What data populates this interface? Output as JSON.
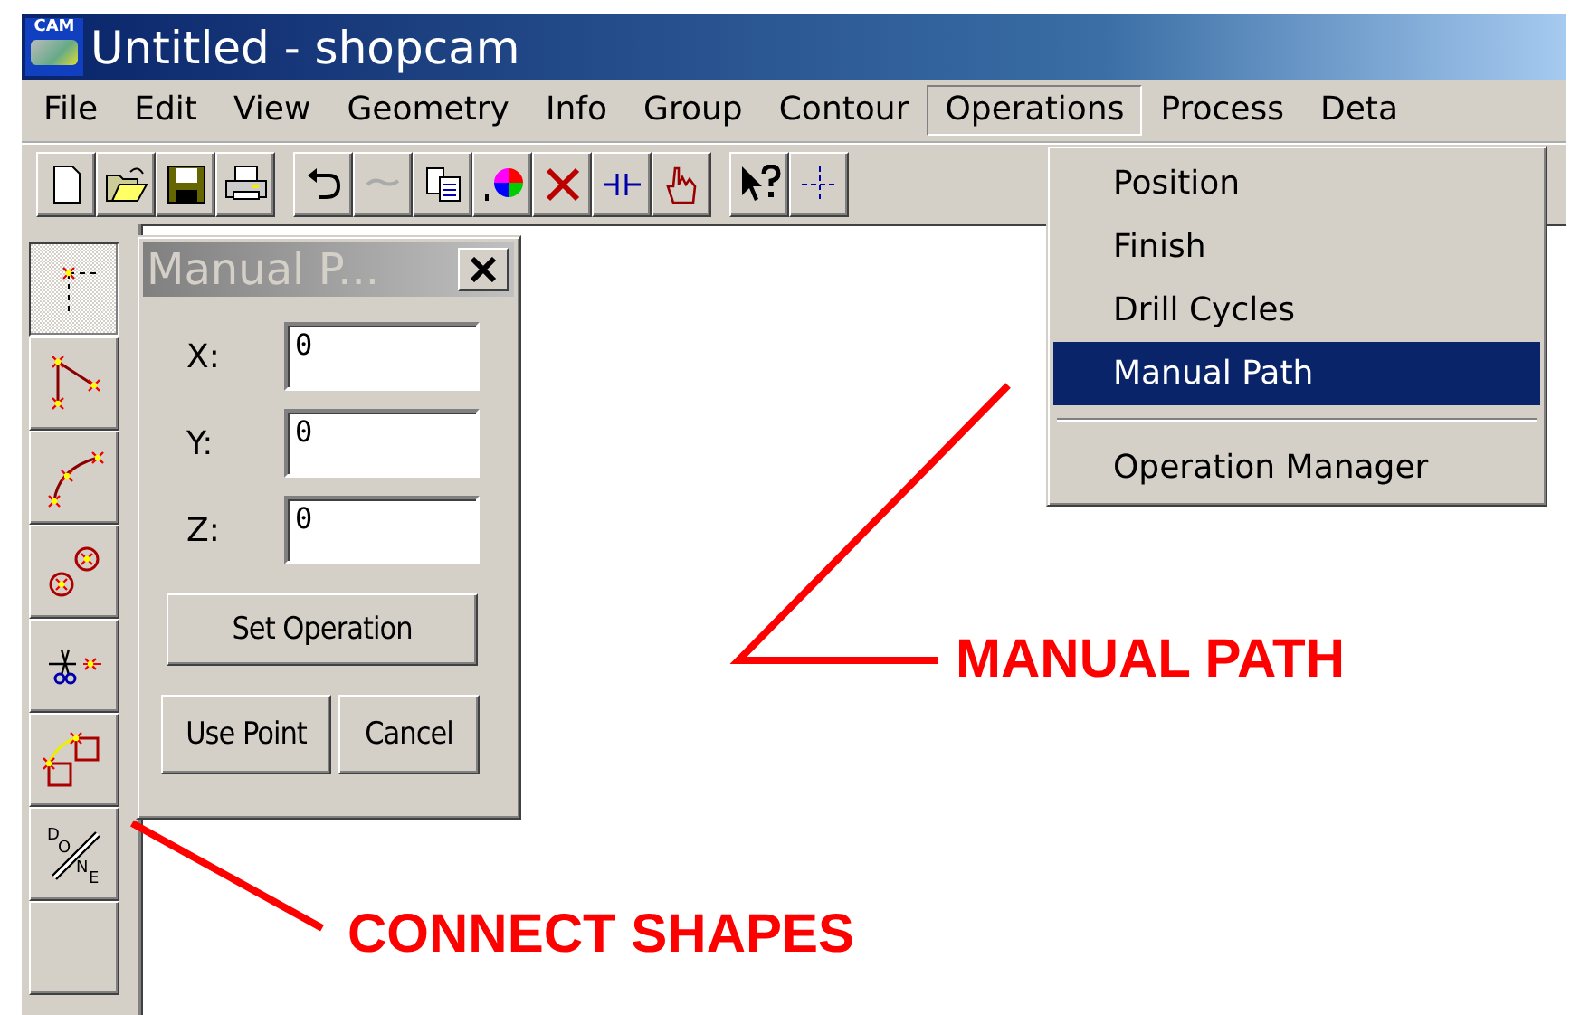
{
  "window": {
    "app_icon_label": "CAM",
    "title": "Untitled - shopcam"
  },
  "menu_bar": [
    {
      "label": "File",
      "selected": false
    },
    {
      "label": "Edit",
      "selected": false
    },
    {
      "label": "View",
      "selected": false
    },
    {
      "label": "Geometry",
      "selected": false
    },
    {
      "label": "Info",
      "selected": false
    },
    {
      "label": "Group",
      "selected": false
    },
    {
      "label": "Contour",
      "selected": false
    },
    {
      "label": "Operations",
      "selected": true
    },
    {
      "label": "Process",
      "selected": false
    },
    {
      "label": "Deta",
      "selected": false
    }
  ],
  "operations_menu": [
    {
      "kind": "item",
      "label": "Position",
      "selected": false
    },
    {
      "kind": "item",
      "label": "Finish",
      "selected": false
    },
    {
      "kind": "item",
      "label": "Drill Cycles",
      "selected": false
    },
    {
      "kind": "item",
      "label": "Manual Path",
      "selected": true
    },
    {
      "kind": "separator"
    },
    {
      "kind": "item",
      "label": "Operation Manager",
      "selected": false
    }
  ],
  "tools": [
    {
      "kind": "point",
      "selected": true
    },
    {
      "kind": "polyline",
      "selected": false
    },
    {
      "kind": "arc",
      "selected": false
    },
    {
      "kind": "circles",
      "selected": false
    },
    {
      "kind": "trim",
      "selected": false
    },
    {
      "kind": "connect",
      "selected": false
    },
    {
      "kind": "done",
      "selected": false,
      "letters": "DONE"
    },
    {
      "kind": "blank",
      "selected": false
    }
  ],
  "dialog": {
    "title": "Manual P...",
    "fields": [
      {
        "label": "X:",
        "value": "0"
      },
      {
        "label": "Y:",
        "value": "0"
      },
      {
        "label": "Z:",
        "value": "0"
      }
    ],
    "buttons": [
      "Set Operation",
      "Use Point",
      "Cancel"
    ]
  },
  "annotations": [
    {
      "kind": "manual",
      "text": "MANUAL PATH"
    },
    {
      "kind": "connect",
      "text": "CONNECT SHAPES"
    }
  ]
}
